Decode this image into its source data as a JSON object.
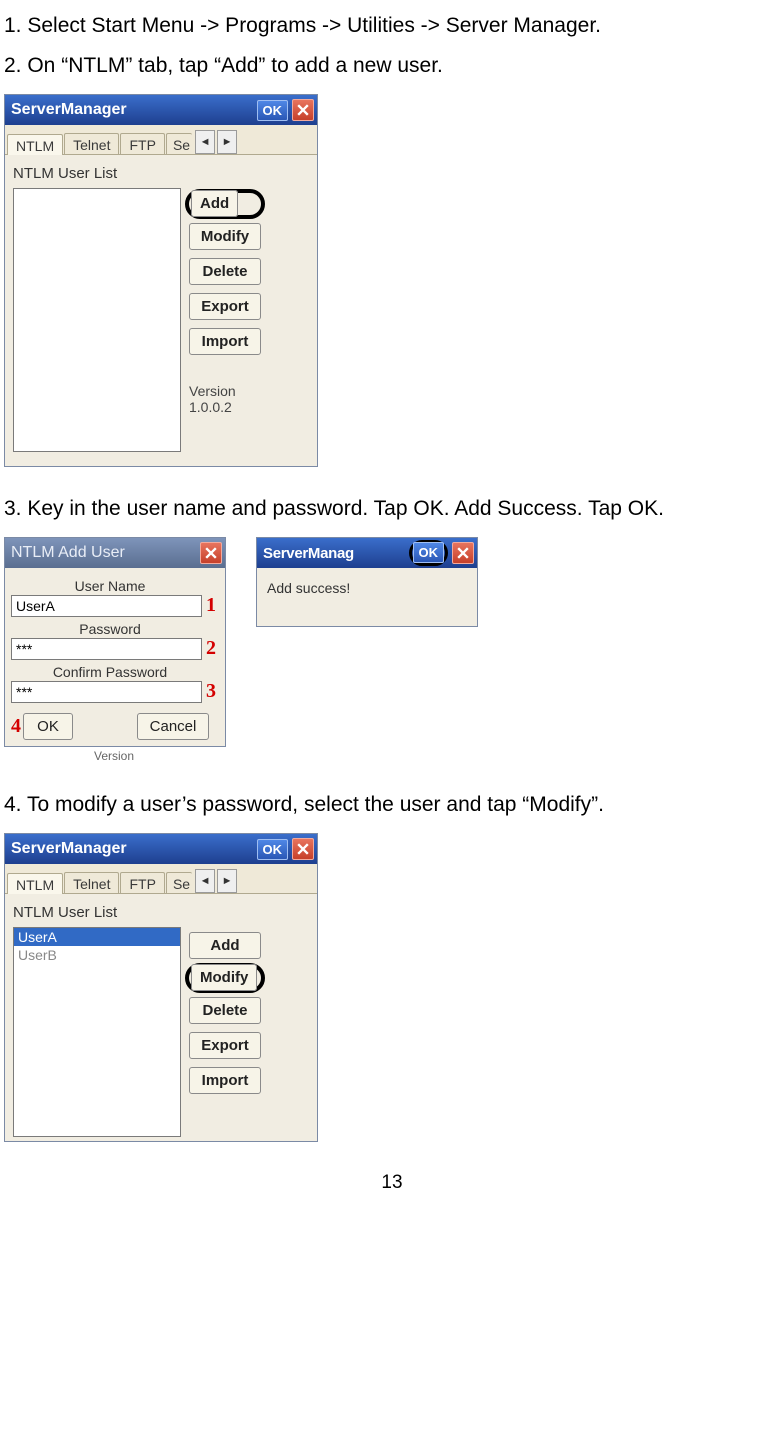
{
  "steps": {
    "s1": "1. Select Start Menu -> Programs -> Utilities -> Server Manager.",
    "s2": "2. On “NTLM” tab, tap “Add” to add a new user.",
    "s3": "3. Key in the user name and password. Tap OK. Add Success. Tap OK.",
    "s4": "4. To modify a user’s password, select the user and tap “Modify”."
  },
  "serverManager": {
    "title": "ServerManager",
    "okLabel": "OK",
    "tabs": {
      "ntlm": "NTLM",
      "telnet": "Telnet",
      "ftp": "FTP",
      "partial": "Se"
    },
    "listLabel": "NTLM User List",
    "buttons": {
      "add": "Add",
      "modify": "Modify",
      "delete": "Delete",
      "export": "Export",
      "import": "Import"
    },
    "versionLabel": "Version",
    "versionValue": "1.0.0.2",
    "users": {
      "userA": "UserA",
      "userB": "UserB"
    }
  },
  "addUser": {
    "title": "NTLM Add User",
    "labels": {
      "userName": "User Name",
      "password": "Password",
      "confirm": "Confirm Password"
    },
    "values": {
      "userName": "UserA",
      "password": "***",
      "confirm": "***"
    },
    "markers": {
      "m1": "1",
      "m2": "2",
      "m3": "3",
      "m4": "4"
    },
    "buttons": {
      "ok": "OK",
      "cancel": "Cancel"
    },
    "bgVersion": "Version"
  },
  "successDialog": {
    "titlePartial": "ServerManag",
    "okLabel": "OK",
    "message": "Add success!"
  },
  "page": {
    "number": "13"
  }
}
